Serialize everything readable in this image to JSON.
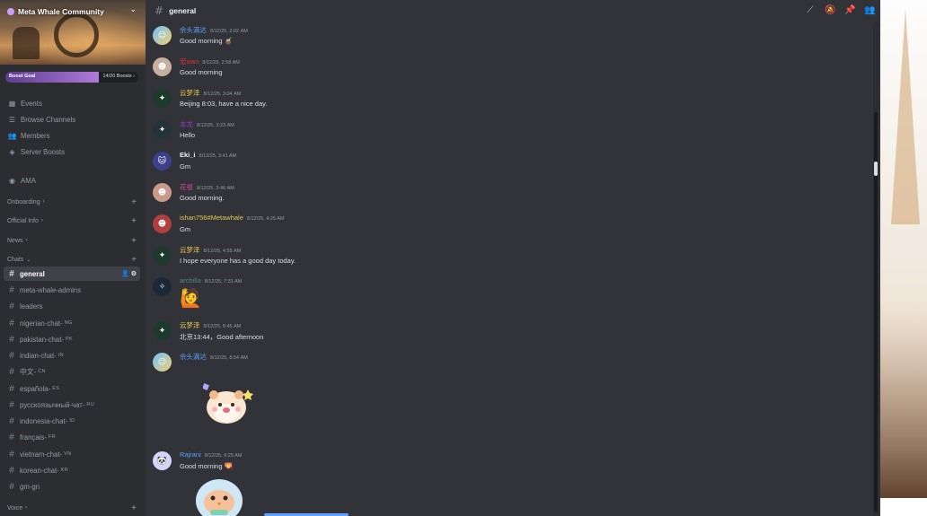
{
  "server": {
    "name": "Meta Whale Community"
  },
  "boost": {
    "goal_label": "Boost Goal",
    "count": "14/20 Boosts",
    "progress": 0.7
  },
  "nav": [
    {
      "label": "Events",
      "icon": "calendar-icon"
    },
    {
      "label": "Browse Channels",
      "icon": "browse-channels-icon"
    },
    {
      "label": "Members",
      "icon": "members-icon"
    },
    {
      "label": "Server Boosts",
      "icon": "boost-icon"
    },
    {
      "label": "AMA",
      "icon": "stage-icon"
    }
  ],
  "categories": {
    "onboarding": "Onboarding",
    "official_info": "Official Info",
    "news": "News",
    "chats": "Chats",
    "voice": "Voice"
  },
  "channels": [
    {
      "name": "general",
      "suffix": ""
    },
    {
      "name": "meta-whale-admins",
      "suffix": ""
    },
    {
      "name": "leaders",
      "suffix": ""
    },
    {
      "name": "nigerian-chat-",
      "suffix": "NG"
    },
    {
      "name": "pakistan-chat-",
      "suffix": "PK"
    },
    {
      "name": "indian-chat-",
      "suffix": "IN"
    },
    {
      "name": "中文-",
      "suffix": "CN"
    },
    {
      "name": "española-",
      "suffix": "ES"
    },
    {
      "name": "русскоязычный-чат-",
      "suffix": "RU"
    },
    {
      "name": "indonesia-chat-",
      "suffix": "ID"
    },
    {
      "name": "français-",
      "suffix": "FR"
    },
    {
      "name": "vietnam-chat-",
      "suffix": "VN"
    },
    {
      "name": "korean-chat-",
      "suffix": "KR"
    },
    {
      "name": "gm-gn",
      "suffix": ""
    }
  ],
  "topbar": {
    "channel": "general"
  },
  "messages": [
    {
      "author": "佘头滴达",
      "color": "#5ea1ff",
      "time": "8/12/25, 2:02 AM",
      "text": "Good morning 🧉"
    },
    {
      "author": "宏wan",
      "color": "#e0303a",
      "time": "8/12/25, 2:58 AM",
      "text": "Good morning"
    },
    {
      "author": "云梦泽",
      "color": "#e6c94c",
      "time": "8/12/25, 3:04 AM",
      "text": "Beijing 8:03, have a nice day."
    },
    {
      "author": "本龙",
      "color": "#8a3fc9",
      "time": "8/12/25, 3:23 AM",
      "text": "Hello"
    },
    {
      "author": "Eki_i",
      "color": "#f2f3f5",
      "time": "8/12/25, 3:41 AM",
      "text": "Gm"
    },
    {
      "author": "花祖",
      "color": "#d04a9e",
      "time": "8/12/25, 3:46 AM",
      "text": "Good morning."
    },
    {
      "author": "ishan756#Metawhale",
      "color": "#e6c94c",
      "time": "8/12/25, 4:25 AM",
      "text": "Gm"
    },
    {
      "author": "云梦泽",
      "color": "#e6c94c",
      "time": "8/12/25, 4:58 AM",
      "text": "I hope everyone has a good day today."
    },
    {
      "author": "archilla",
      "color": "#4f8b7e",
      "time": "8/12/25, 7:31 AM",
      "text": ""
    },
    {
      "author": "云梦泽",
      "color": "#e6c94c",
      "time": "8/12/25, 8:45 AM",
      "text": "北京13:44，Good afternoon"
    },
    {
      "author": "佘头滴达",
      "color": "#5ea1ff",
      "time": "8/12/25, 8:54 AM",
      "text": ""
    },
    {
      "author": "Rajrani",
      "color": "#5ea1ff",
      "time": "8/12/25, 9:25 AM",
      "text": "Good morning 🌄"
    }
  ]
}
